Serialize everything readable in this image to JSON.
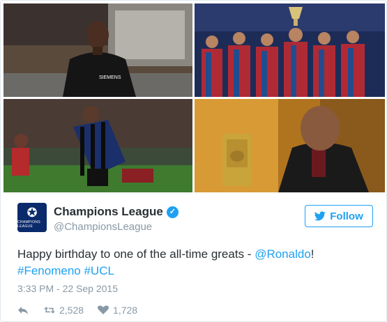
{
  "account": {
    "display_name": "Champions League",
    "handle": "@ChampionsLeague",
    "avatar_text": "CHAMPIONS LEAGUE"
  },
  "follow_button": {
    "label": "Follow"
  },
  "tweet": {
    "text_prefix": "Happy birthday to one of the all-time greats - ",
    "mention": "@Ronaldo",
    "text_suffix": "!",
    "hashtag1": "#Fenomeno",
    "hashtag2": "#UCL",
    "timestamp": "3:33 PM - 22 Sep 2015"
  },
  "stats": {
    "retweets": "2,528",
    "likes": "1,728"
  },
  "photos": {
    "photo1_sponsor": "SIEMENS"
  },
  "colors": {
    "accent": "#1da1f2",
    "text": "#292f33",
    "muted": "#8899a6",
    "avatar_bg": "#0a2a6b"
  }
}
